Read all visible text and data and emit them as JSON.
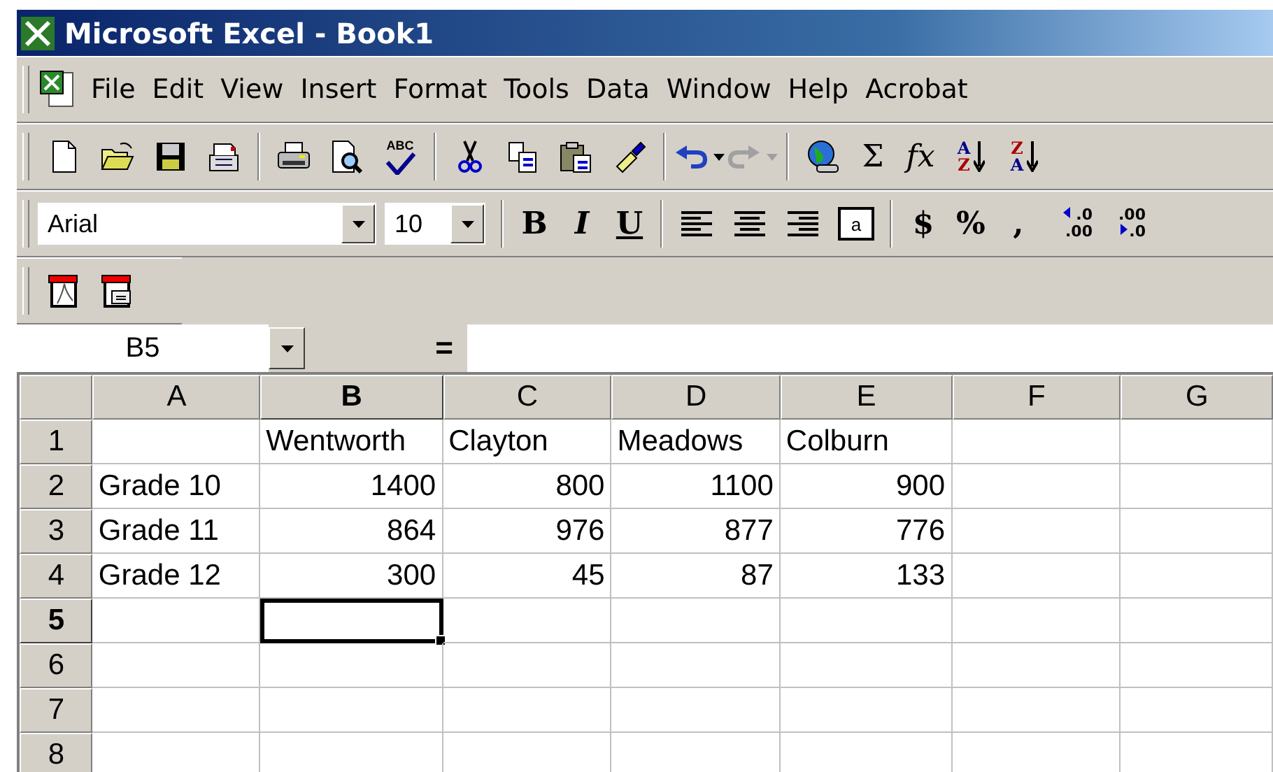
{
  "window": {
    "title": "Microsoft Excel - Book1"
  },
  "menu_bar": {
    "items": [
      "File",
      "Edit",
      "View",
      "Insert",
      "Format",
      "Tools",
      "Data",
      "Window",
      "Help",
      "Acrobat"
    ]
  },
  "standard_toolbar": [
    {
      "kind": "new"
    },
    {
      "kind": "open"
    },
    {
      "kind": "save"
    },
    {
      "kind": "mail"
    },
    {
      "kind": "separator"
    },
    {
      "kind": "print"
    },
    {
      "kind": "preview"
    },
    {
      "kind": "spell",
      "text": "ABC"
    },
    {
      "kind": "separator"
    },
    {
      "kind": "cut"
    },
    {
      "kind": "copy"
    },
    {
      "kind": "paste"
    },
    {
      "kind": "brush"
    },
    {
      "kind": "separator"
    },
    {
      "kind": "undo",
      "disabled": false
    },
    {
      "kind": "redo",
      "disabled": true
    },
    {
      "kind": "separator"
    },
    {
      "kind": "globe"
    },
    {
      "kind": "glyph",
      "text": "Σ"
    },
    {
      "kind": "glyph",
      "text": "fx",
      "italic": true
    },
    {
      "kind": "sort",
      "top": "A",
      "bottom": "Z"
    },
    {
      "kind": "sort",
      "top": "Z",
      "bottom": "A"
    }
  ],
  "formatting_toolbar": {
    "font": "Arial",
    "size": "10",
    "buttons": [
      {
        "kind": "separator"
      },
      {
        "kind": "glyph",
        "text": "B",
        "bold": true
      },
      {
        "kind": "glyph",
        "text": "I",
        "italic": true,
        "bold": true
      },
      {
        "kind": "glyph",
        "text": "U",
        "underline": true,
        "bold": true
      },
      {
        "kind": "separator"
      },
      {
        "kind": "align-left"
      },
      {
        "kind": "align-center"
      },
      {
        "kind": "align-right"
      },
      {
        "kind": "merge",
        "text": "a"
      },
      {
        "kind": "separator"
      },
      {
        "kind": "glyph",
        "text": "$",
        "bold": true
      },
      {
        "kind": "glyph",
        "text": "%",
        "bold": true
      },
      {
        "kind": "glyph",
        "text": ",",
        "bold": true
      },
      {
        "kind": "decimal-more",
        "top": ".0",
        "bottom": ".00"
      },
      {
        "kind": "decimal-less",
        "top": ".00",
        "bottom": ".0"
      }
    ]
  },
  "acrobat_toolbar": [
    {
      "kind": "pdf"
    },
    {
      "kind": "pdf-mail"
    }
  ],
  "formula_bar": {
    "name_box": "B5",
    "equals": "="
  },
  "sheet": {
    "columns": [
      {
        "label": "A",
        "selected": false
      },
      {
        "label": "B",
        "selected": true
      },
      {
        "label": "C",
        "selected": false
      },
      {
        "label": "D",
        "selected": false
      },
      {
        "label": "E",
        "selected": false
      },
      {
        "label": "F",
        "selected": false
      },
      {
        "label": "G",
        "selected": false
      }
    ],
    "rows": [
      {
        "label": "1",
        "selected": false,
        "cells": [
          {
            "selected": false
          },
          {
            "kind": "text",
            "text": "Wentworth",
            "selected": false
          },
          {
            "kind": "text",
            "text": "Clayton",
            "selected": false
          },
          {
            "kind": "text",
            "text": "Meadows",
            "selected": false
          },
          {
            "kind": "text",
            "text": "Colburn",
            "selected": false
          },
          {
            "selected": false
          },
          {
            "selected": false
          }
        ]
      },
      {
        "label": "2",
        "selected": false,
        "cells": [
          {
            "kind": "text",
            "text": "Grade 10",
            "selected": false
          },
          {
            "kind": "number",
            "text": "1400",
            "selected": false
          },
          {
            "kind": "number",
            "text": "800",
            "selected": false
          },
          {
            "kind": "number",
            "text": "1100",
            "selected": false
          },
          {
            "kind": "number",
            "text": "900",
            "selected": false
          },
          {
            "selected": false
          },
          {
            "selected": false
          }
        ]
      },
      {
        "label": "3",
        "selected": false,
        "cells": [
          {
            "kind": "text",
            "text": "Grade 11",
            "selected": false
          },
          {
            "kind": "number",
            "text": "864",
            "selected": false
          },
          {
            "kind": "number",
            "text": "976",
            "selected": false
          },
          {
            "kind": "number",
            "text": "877",
            "selected": false
          },
          {
            "kind": "number",
            "text": "776",
            "selected": false
          },
          {
            "selected": false
          },
          {
            "selected": false
          }
        ]
      },
      {
        "label": "4",
        "selected": false,
        "cells": [
          {
            "kind": "text",
            "text": "Grade 12",
            "selected": false
          },
          {
            "kind": "number",
            "text": "300",
            "selected": false
          },
          {
            "kind": "number",
            "text": "45",
            "selected": false
          },
          {
            "kind": "number",
            "text": "87",
            "selected": false
          },
          {
            "kind": "number",
            "text": "133",
            "selected": false
          },
          {
            "selected": false
          },
          {
            "selected": false
          }
        ]
      },
      {
        "label": "5",
        "selected": true,
        "cells": [
          {
            "selected": false
          },
          {
            "selected": true
          },
          {
            "selected": false
          },
          {
            "selected": false
          },
          {
            "selected": false
          },
          {
            "selected": false
          },
          {
            "selected": false
          }
        ]
      },
      {
        "label": "6",
        "selected": false,
        "cells": [
          {
            "selected": false
          },
          {
            "selected": false
          },
          {
            "selected": false
          },
          {
            "selected": false
          },
          {
            "selected": false
          },
          {
            "selected": false
          },
          {
            "selected": false
          }
        ]
      },
      {
        "label": "7",
        "selected": false,
        "cells": [
          {
            "selected": false
          },
          {
            "selected": false
          },
          {
            "selected": false
          },
          {
            "selected": false
          },
          {
            "selected": false
          },
          {
            "selected": false
          },
          {
            "selected": false
          }
        ]
      },
      {
        "label": "8",
        "selected": false,
        "cells": [
          {
            "selected": false
          },
          {
            "selected": false
          },
          {
            "selected": false
          },
          {
            "selected": false
          },
          {
            "selected": false
          },
          {
            "selected": false
          },
          {
            "selected": false
          }
        ]
      }
    ]
  }
}
